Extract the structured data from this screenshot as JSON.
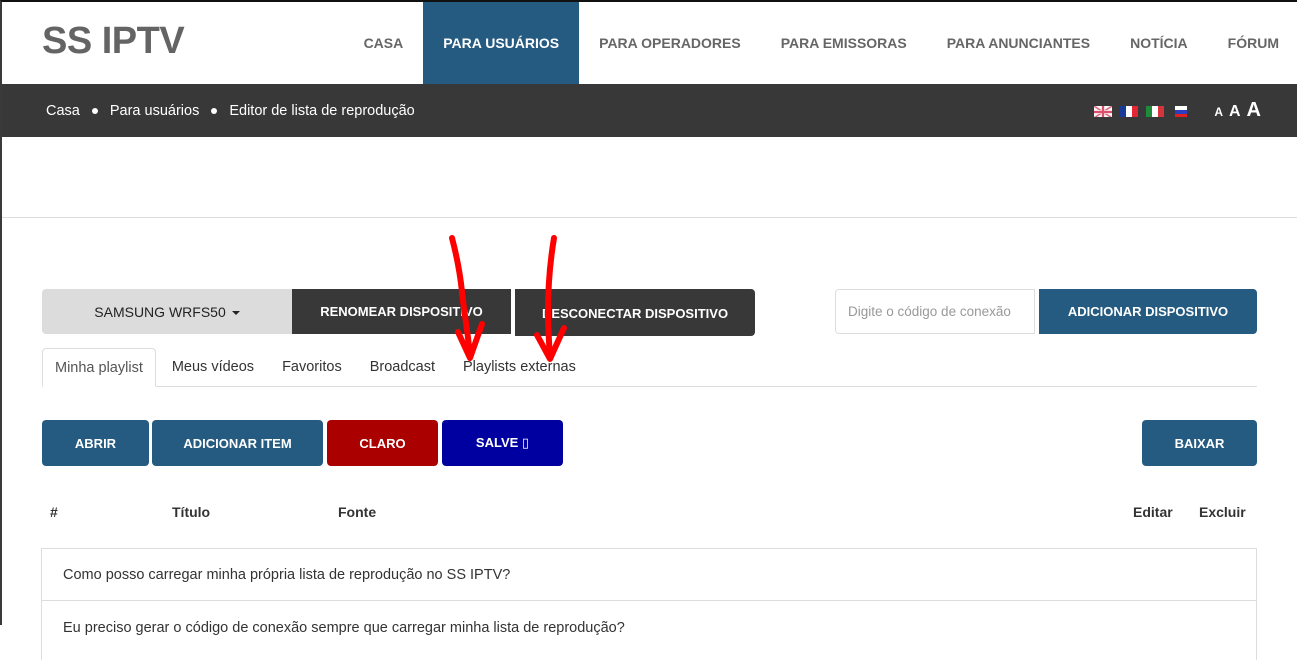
{
  "header": {
    "logo": "SS IPTV",
    "nav": [
      {
        "label": "CASA",
        "active": false
      },
      {
        "label": "PARA USUÁRIOS",
        "active": true
      },
      {
        "label": "PARA OPERADORES",
        "active": false
      },
      {
        "label": "PARA EMISSORAS",
        "active": false
      },
      {
        "label": "PARA ANUNCIANTES",
        "active": false
      },
      {
        "label": "NOTÍCIA",
        "active": false
      },
      {
        "label": "FÓRUM",
        "active": false
      }
    ]
  },
  "breadcrumb": [
    "Casa",
    "Para usuários",
    "Editor de lista de reprodução"
  ],
  "languages": [
    "english-flag",
    "french-flag",
    "italian-flag",
    "russian-flag"
  ],
  "font_sizes": [
    "A",
    "A",
    "A"
  ],
  "device": {
    "selected": "SAMSUNG WRFS50",
    "rename_label": "RENOMEAR DISPOSITIVO",
    "disconnect_label": "DESCONECTAR DISPOSITIVO",
    "code_placeholder": "Digite o código de conexão",
    "code_value": "",
    "add_label": "ADICIONAR DISPOSITIVO"
  },
  "tabs": [
    {
      "label": "Minha playlist",
      "active": true
    },
    {
      "label": "Meus vídeos",
      "active": false
    },
    {
      "label": "Favoritos",
      "active": false
    },
    {
      "label": "Broadcast",
      "active": false
    },
    {
      "label": "Playlists externas",
      "active": false
    }
  ],
  "toolbar": {
    "open_label": "ABRIR",
    "add_item_label": "ADICIONAR ITEM",
    "clear_label": "CLARO",
    "save_label": "SALVE ▯",
    "download_label": "BAIXAR"
  },
  "table": {
    "columns": [
      "#",
      "Título",
      "Fonte",
      "Editar",
      "Excluir"
    ]
  },
  "faq": [
    "Como posso carregar minha própria lista de reprodução no SS IPTV?",
    "Eu preciso gerar o código de conexão sempre que carregar minha lista de reprodução?"
  ],
  "colors": {
    "primary": "#255b80",
    "dark": "#383838",
    "danger": "#aa0000",
    "save": "#0000a0",
    "annotation": "#ff0000"
  }
}
